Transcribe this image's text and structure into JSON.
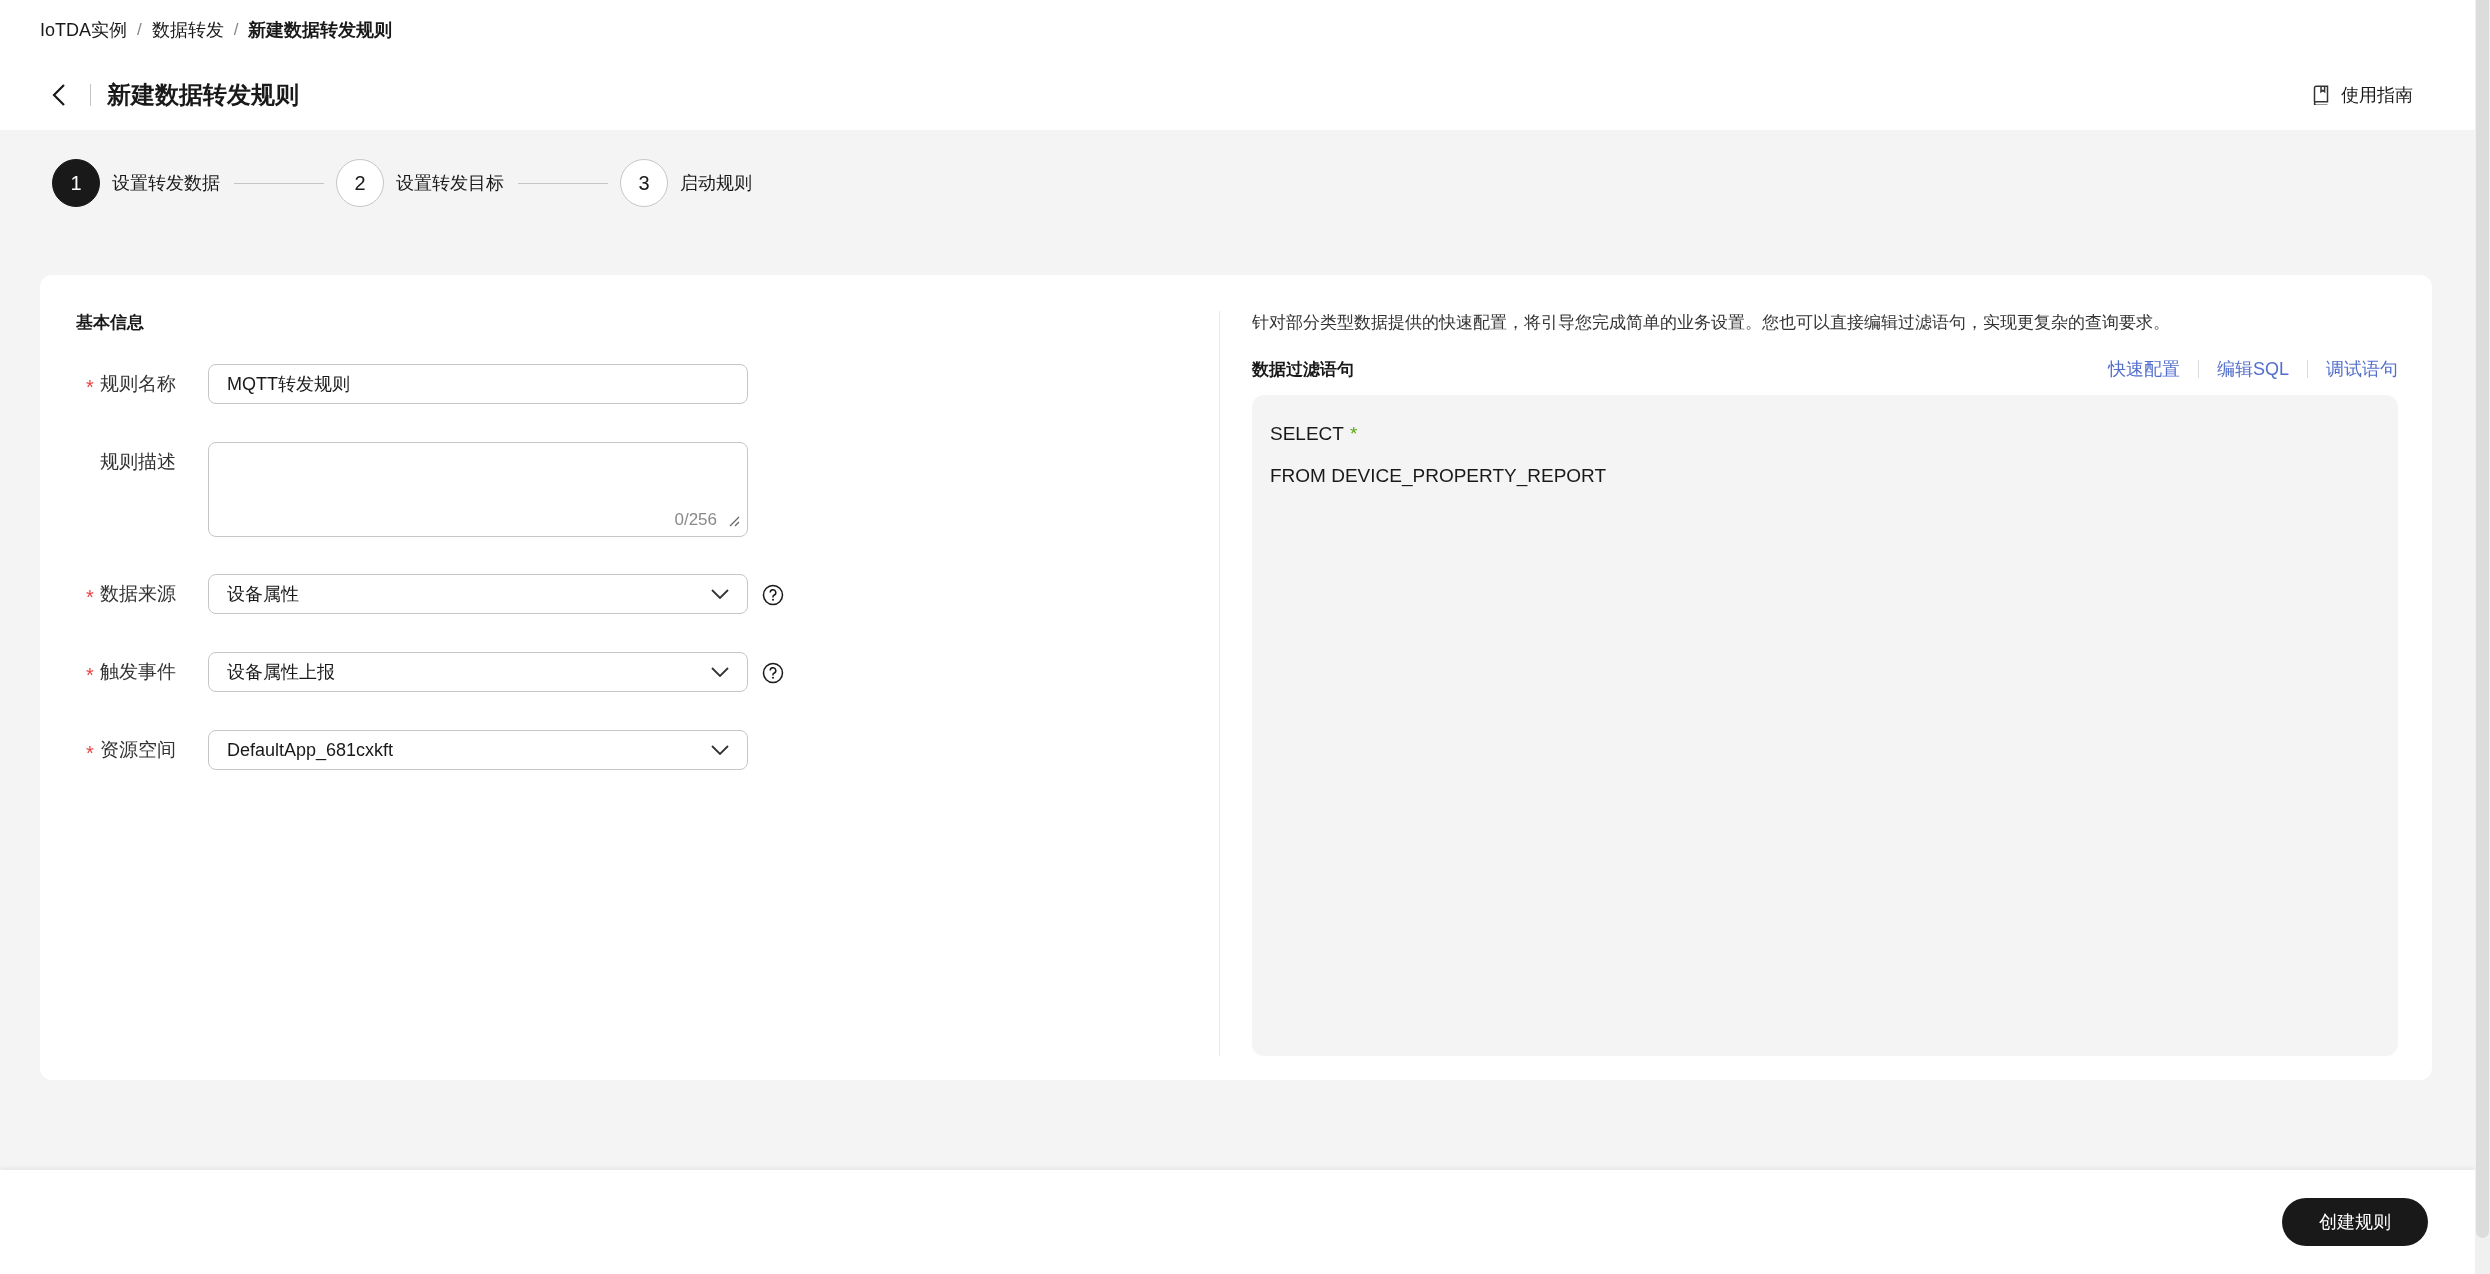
{
  "breadcrumb": [
    {
      "label": "IoTDA实例",
      "current": false
    },
    {
      "separator": "/",
      "label": "数据转发",
      "current": false
    },
    {
      "separator": "/",
      "label": "新建数据转发规则",
      "current": true
    }
  ],
  "header": {
    "title": "新建数据转发规则",
    "guide_link": "使用指南"
  },
  "steps": [
    {
      "number": "1",
      "label": "设置转发数据",
      "selected": true
    },
    {
      "number": "2",
      "label": "设置转发目标",
      "selected": false
    },
    {
      "number": "3",
      "label": "启动规则",
      "selected": false
    }
  ],
  "basic_info": {
    "title": "基本信息",
    "fields": [
      {
        "kind": "text",
        "label": "规则名称",
        "required": true,
        "value": "MQTT转发规则",
        "help": false
      },
      {
        "kind": "textarea",
        "label": "规则描述",
        "required": false,
        "counter": "0/256",
        "help": false
      },
      {
        "kind": "select",
        "label": "数据来源",
        "required": true,
        "value": "设备属性",
        "help": true
      },
      {
        "kind": "select",
        "label": "触发事件",
        "required": true,
        "value": "设备属性上报",
        "help": true
      },
      {
        "kind": "select",
        "label": "资源空间",
        "required": true,
        "value": "DefaultApp_681cxkft",
        "help": false
      }
    ]
  },
  "filter": {
    "description": "针对部分类型数据提供的快速配置，将引导您完成简单的业务设置。您也可以直接编辑过滤语句，实现更复杂的查询要求。",
    "title": "数据过滤语句",
    "actions": [
      "快速配置",
      "编辑SQL",
      "调试语句"
    ],
    "code_lines": [
      {
        "tokens": [
          {
            "text": "SELECT",
            "kind": "keyword"
          },
          {
            "text": "*",
            "kind": "wildcard"
          }
        ]
      },
      {
        "tokens": [
          {
            "text": "FROM DEVICE_PROPERTY_REPORT",
            "kind": "keyword"
          }
        ]
      }
    ]
  },
  "footer": {
    "submit": "创建规则"
  }
}
